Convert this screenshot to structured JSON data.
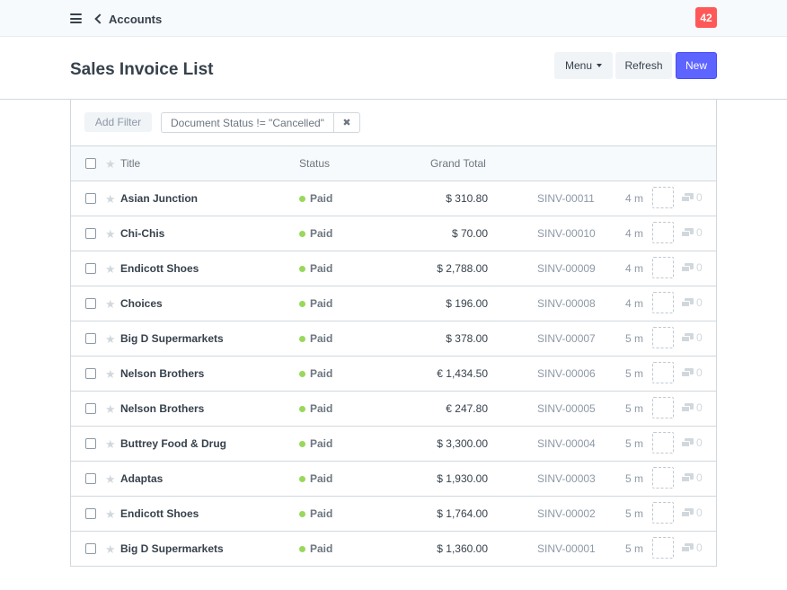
{
  "navbar": {
    "back_label": "Accounts",
    "notification_count": "42",
    "icons": {
      "menu": "hamburger-icon",
      "back": "chevron-left-icon"
    }
  },
  "page": {
    "title": "Sales Invoice List",
    "buttons": {
      "menu": "Menu",
      "refresh": "Refresh",
      "new": "New"
    }
  },
  "filters": {
    "add_filter_label": "Add Filter",
    "active": [
      {
        "label": "Document Status != \"Cancelled\"",
        "remove_icon": "close-icon"
      }
    ]
  },
  "list": {
    "columns": {
      "title": "Title",
      "status": "Status",
      "grand_total": "Grand Total"
    },
    "rows": [
      {
        "title": "Asian Junction",
        "status": "Paid",
        "total": "$ 310.80",
        "name": "SINV-00011",
        "modified": "4 m",
        "comments": "0"
      },
      {
        "title": "Chi-Chis",
        "status": "Paid",
        "total": "$ 70.00",
        "name": "SINV-00010",
        "modified": "4 m",
        "comments": "0"
      },
      {
        "title": "Endicott Shoes",
        "status": "Paid",
        "total": "$ 2,788.00",
        "name": "SINV-00009",
        "modified": "4 m",
        "comments": "0"
      },
      {
        "title": "Choices",
        "status": "Paid",
        "total": "$ 196.00",
        "name": "SINV-00008",
        "modified": "4 m",
        "comments": "0"
      },
      {
        "title": "Big D Supermarkets",
        "status": "Paid",
        "total": "$ 378.00",
        "name": "SINV-00007",
        "modified": "5 m",
        "comments": "0"
      },
      {
        "title": "Nelson Brothers",
        "status": "Paid",
        "total": "€ 1,434.50",
        "name": "SINV-00006",
        "modified": "5 m",
        "comments": "0"
      },
      {
        "title": "Nelson Brothers",
        "status": "Paid",
        "total": "€ 247.80",
        "name": "SINV-00005",
        "modified": "5 m",
        "comments": "0"
      },
      {
        "title": "Buttrey Food & Drug",
        "status": "Paid",
        "total": "$ 3,300.00",
        "name": "SINV-00004",
        "modified": "5 m",
        "comments": "0"
      },
      {
        "title": "Adaptas",
        "status": "Paid",
        "total": "$ 1,930.00",
        "name": "SINV-00003",
        "modified": "5 m",
        "comments": "0"
      },
      {
        "title": "Endicott Shoes",
        "status": "Paid",
        "total": "$ 1,764.00",
        "name": "SINV-00002",
        "modified": "5 m",
        "comments": "0"
      },
      {
        "title": "Big D Supermarkets",
        "status": "Paid",
        "total": "$ 1,360.00",
        "name": "SINV-00001",
        "modified": "5 m",
        "comments": "0"
      }
    ]
  },
  "colors": {
    "primary": "#5e64ff",
    "badge": "#ff5858",
    "paid_indicator": "#98d85b"
  }
}
